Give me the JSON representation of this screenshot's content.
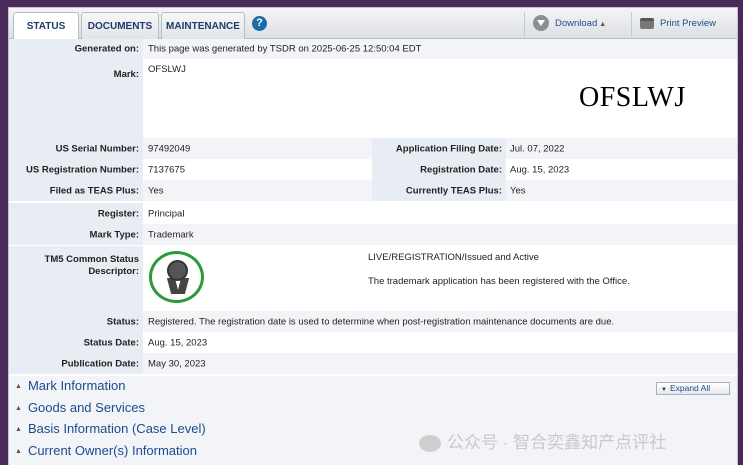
{
  "tabs": [
    {
      "label": "STATUS"
    },
    {
      "label": "DOCUMENTS"
    },
    {
      "label": "MAINTENANCE"
    }
  ],
  "help_label": "?",
  "toolbar": {
    "download": "Download",
    "print": "Print Preview"
  },
  "fields": {
    "generated_label": "Generated on:",
    "generated_value": "This page was generated by TSDR on 2025-06-25 12:50:04 EDT",
    "mark_label": "Mark:",
    "mark_value": "OFSLWJ",
    "mark_image_text": "OFSLWJ",
    "serial_label": "US Serial Number:",
    "serial_value": "97492049",
    "filing_label": "Application Filing Date:",
    "filing_value": "Jul. 07, 2022",
    "reg_num_label": "US Registration Number:",
    "reg_num_value": "7137675",
    "reg_date_label": "Registration Date:",
    "reg_date_value": "Aug. 15, 2023",
    "teas_label": "Filed as TEAS Plus:",
    "teas_value": "Yes",
    "cur_teas_label": "Currently TEAS Plus:",
    "cur_teas_value": "Yes",
    "register_label": "Register:",
    "register_value": "Principal",
    "marktype_label": "Mark Type:",
    "marktype_value": "Trademark",
    "tm5_label_1": "TM5 Common Status",
    "tm5_label_2": "Descriptor:",
    "tm5_status": "LIVE/REGISTRATION/Issued and Active",
    "tm5_desc": "The trademark application has been registered with the Office.",
    "status_label": "Status:",
    "status_value": "Registered. The registration date is used to determine when post-registration maintenance documents are due.",
    "status_date_label": "Status Date:",
    "status_date_value": "Aug. 15, 2023",
    "pub_date_label": "Publication Date:",
    "pub_date_value": "May 30, 2023"
  },
  "sections": [
    {
      "label": "Mark Information"
    },
    {
      "label": "Goods and Services"
    },
    {
      "label": "Basis Information (Case Level)"
    },
    {
      "label": "Current Owner(s) Information"
    }
  ],
  "expand_all": "Expand All",
  "watermark": "公众号 · 智合奕鑫知产点评社",
  "colors": {
    "link": "#1b4c8a",
    "label_bg": "#e8ecf3",
    "seal": "#2a9a3a"
  }
}
